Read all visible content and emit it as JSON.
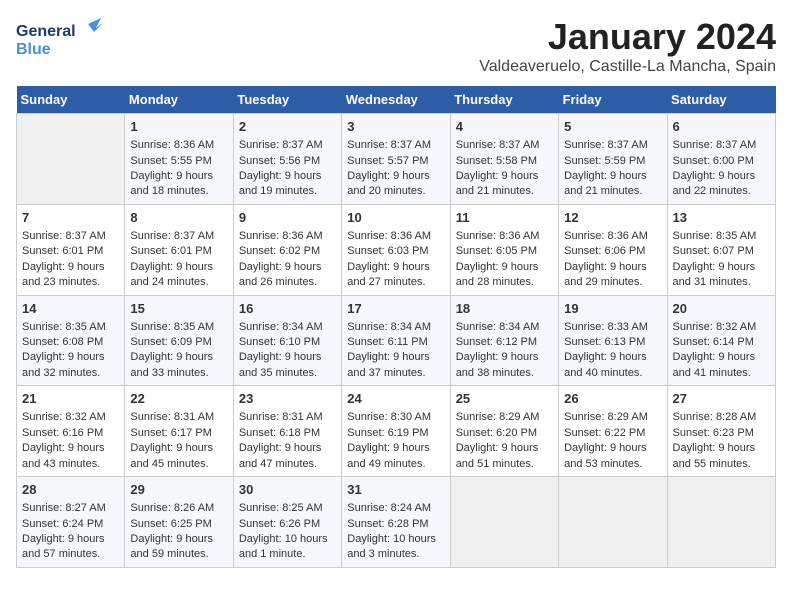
{
  "logo": {
    "line1": "General",
    "line2": "Blue"
  },
  "title": "January 2024",
  "location": "Valdeaveruelo, Castille-La Mancha, Spain",
  "weekdays": [
    "Sunday",
    "Monday",
    "Tuesday",
    "Wednesday",
    "Thursday",
    "Friday",
    "Saturday"
  ],
  "weeks": [
    [
      {
        "day": "",
        "sunrise": "",
        "sunset": "",
        "daylight": ""
      },
      {
        "day": "1",
        "sunrise": "Sunrise: 8:36 AM",
        "sunset": "Sunset: 5:55 PM",
        "daylight": "Daylight: 9 hours and 18 minutes."
      },
      {
        "day": "2",
        "sunrise": "Sunrise: 8:37 AM",
        "sunset": "Sunset: 5:56 PM",
        "daylight": "Daylight: 9 hours and 19 minutes."
      },
      {
        "day": "3",
        "sunrise": "Sunrise: 8:37 AM",
        "sunset": "Sunset: 5:57 PM",
        "daylight": "Daylight: 9 hours and 20 minutes."
      },
      {
        "day": "4",
        "sunrise": "Sunrise: 8:37 AM",
        "sunset": "Sunset: 5:58 PM",
        "daylight": "Daylight: 9 hours and 21 minutes."
      },
      {
        "day": "5",
        "sunrise": "Sunrise: 8:37 AM",
        "sunset": "Sunset: 5:59 PM",
        "daylight": "Daylight: 9 hours and 21 minutes."
      },
      {
        "day": "6",
        "sunrise": "Sunrise: 8:37 AM",
        "sunset": "Sunset: 6:00 PM",
        "daylight": "Daylight: 9 hours and 22 minutes."
      }
    ],
    [
      {
        "day": "7",
        "sunrise": "Sunrise: 8:37 AM",
        "sunset": "Sunset: 6:01 PM",
        "daylight": "Daylight: 9 hours and 23 minutes."
      },
      {
        "day": "8",
        "sunrise": "Sunrise: 8:37 AM",
        "sunset": "Sunset: 6:01 PM",
        "daylight": "Daylight: 9 hours and 24 minutes."
      },
      {
        "day": "9",
        "sunrise": "Sunrise: 8:36 AM",
        "sunset": "Sunset: 6:02 PM",
        "daylight": "Daylight: 9 hours and 26 minutes."
      },
      {
        "day": "10",
        "sunrise": "Sunrise: 8:36 AM",
        "sunset": "Sunset: 6:03 PM",
        "daylight": "Daylight: 9 hours and 27 minutes."
      },
      {
        "day": "11",
        "sunrise": "Sunrise: 8:36 AM",
        "sunset": "Sunset: 6:05 PM",
        "daylight": "Daylight: 9 hours and 28 minutes."
      },
      {
        "day": "12",
        "sunrise": "Sunrise: 8:36 AM",
        "sunset": "Sunset: 6:06 PM",
        "daylight": "Daylight: 9 hours and 29 minutes."
      },
      {
        "day": "13",
        "sunrise": "Sunrise: 8:35 AM",
        "sunset": "Sunset: 6:07 PM",
        "daylight": "Daylight: 9 hours and 31 minutes."
      }
    ],
    [
      {
        "day": "14",
        "sunrise": "Sunrise: 8:35 AM",
        "sunset": "Sunset: 6:08 PM",
        "daylight": "Daylight: 9 hours and 32 minutes."
      },
      {
        "day": "15",
        "sunrise": "Sunrise: 8:35 AM",
        "sunset": "Sunset: 6:09 PM",
        "daylight": "Daylight: 9 hours and 33 minutes."
      },
      {
        "day": "16",
        "sunrise": "Sunrise: 8:34 AM",
        "sunset": "Sunset: 6:10 PM",
        "daylight": "Daylight: 9 hours and 35 minutes."
      },
      {
        "day": "17",
        "sunrise": "Sunrise: 8:34 AM",
        "sunset": "Sunset: 6:11 PM",
        "daylight": "Daylight: 9 hours and 37 minutes."
      },
      {
        "day": "18",
        "sunrise": "Sunrise: 8:34 AM",
        "sunset": "Sunset: 6:12 PM",
        "daylight": "Daylight: 9 hours and 38 minutes."
      },
      {
        "day": "19",
        "sunrise": "Sunrise: 8:33 AM",
        "sunset": "Sunset: 6:13 PM",
        "daylight": "Daylight: 9 hours and 40 minutes."
      },
      {
        "day": "20",
        "sunrise": "Sunrise: 8:32 AM",
        "sunset": "Sunset: 6:14 PM",
        "daylight": "Daylight: 9 hours and 41 minutes."
      }
    ],
    [
      {
        "day": "21",
        "sunrise": "Sunrise: 8:32 AM",
        "sunset": "Sunset: 6:16 PM",
        "daylight": "Daylight: 9 hours and 43 minutes."
      },
      {
        "day": "22",
        "sunrise": "Sunrise: 8:31 AM",
        "sunset": "Sunset: 6:17 PM",
        "daylight": "Daylight: 9 hours and 45 minutes."
      },
      {
        "day": "23",
        "sunrise": "Sunrise: 8:31 AM",
        "sunset": "Sunset: 6:18 PM",
        "daylight": "Daylight: 9 hours and 47 minutes."
      },
      {
        "day": "24",
        "sunrise": "Sunrise: 8:30 AM",
        "sunset": "Sunset: 6:19 PM",
        "daylight": "Daylight: 9 hours and 49 minutes."
      },
      {
        "day": "25",
        "sunrise": "Sunrise: 8:29 AM",
        "sunset": "Sunset: 6:20 PM",
        "daylight": "Daylight: 9 hours and 51 minutes."
      },
      {
        "day": "26",
        "sunrise": "Sunrise: 8:29 AM",
        "sunset": "Sunset: 6:22 PM",
        "daylight": "Daylight: 9 hours and 53 minutes."
      },
      {
        "day": "27",
        "sunrise": "Sunrise: 8:28 AM",
        "sunset": "Sunset: 6:23 PM",
        "daylight": "Daylight: 9 hours and 55 minutes."
      }
    ],
    [
      {
        "day": "28",
        "sunrise": "Sunrise: 8:27 AM",
        "sunset": "Sunset: 6:24 PM",
        "daylight": "Daylight: 9 hours and 57 minutes."
      },
      {
        "day": "29",
        "sunrise": "Sunrise: 8:26 AM",
        "sunset": "Sunset: 6:25 PM",
        "daylight": "Daylight: 9 hours and 59 minutes."
      },
      {
        "day": "30",
        "sunrise": "Sunrise: 8:25 AM",
        "sunset": "Sunset: 6:26 PM",
        "daylight": "Daylight: 10 hours and 1 minute."
      },
      {
        "day": "31",
        "sunrise": "Sunrise: 8:24 AM",
        "sunset": "Sunset: 6:28 PM",
        "daylight": "Daylight: 10 hours and 3 minutes."
      },
      {
        "day": "",
        "sunrise": "",
        "sunset": "",
        "daylight": ""
      },
      {
        "day": "",
        "sunrise": "",
        "sunset": "",
        "daylight": ""
      },
      {
        "day": "",
        "sunrise": "",
        "sunset": "",
        "daylight": ""
      }
    ]
  ]
}
